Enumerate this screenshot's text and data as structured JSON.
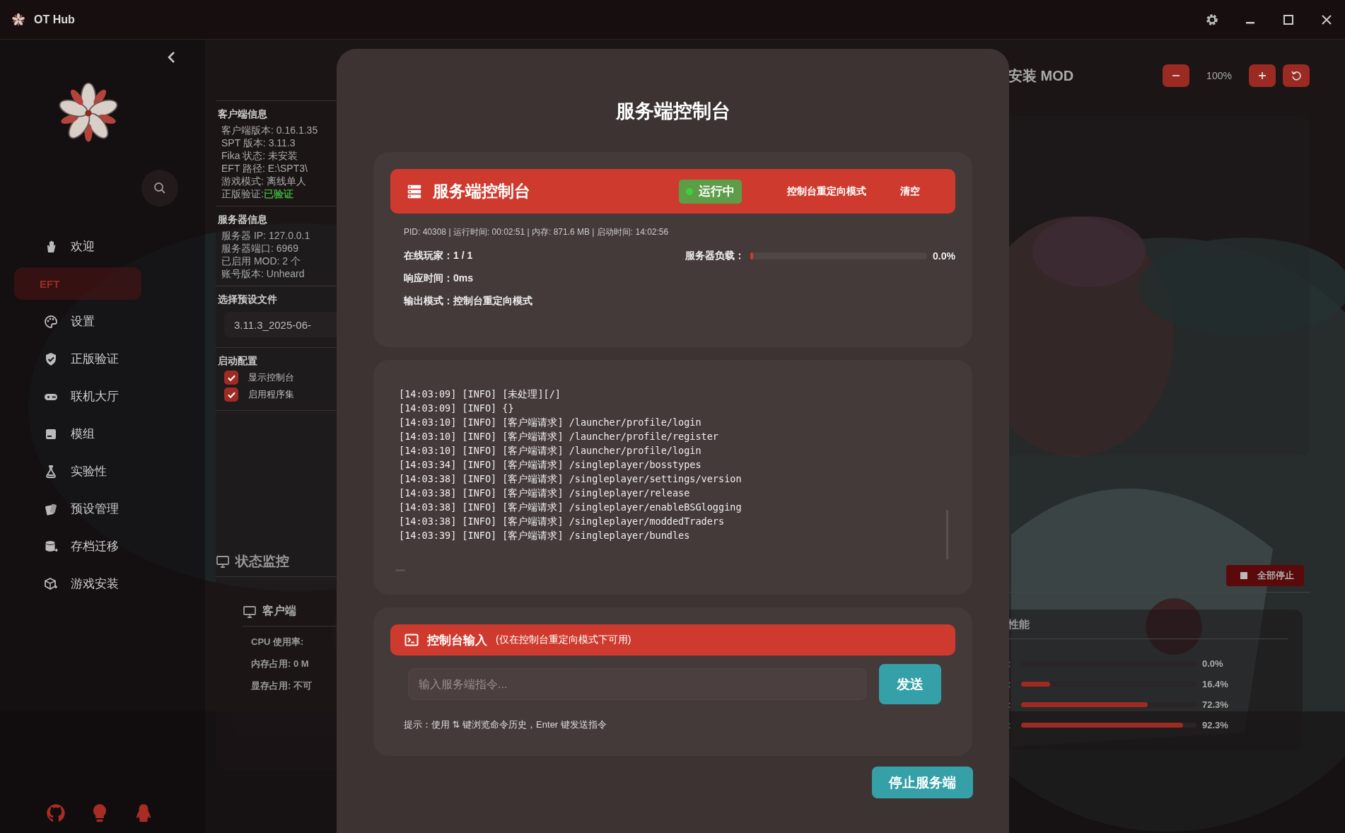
{
  "window": {
    "title": "OT Hub"
  },
  "sidebar": {
    "items": [
      {
        "label": "欢迎",
        "kind": "link",
        "selected": false
      },
      {
        "label": "EFT",
        "kind": "section",
        "selected": true
      },
      {
        "label": "设置",
        "kind": "link",
        "selected": false
      },
      {
        "label": "正版验证",
        "kind": "link",
        "selected": false
      },
      {
        "label": "联机大厅",
        "kind": "link",
        "selected": false
      },
      {
        "label": "模组",
        "kind": "link",
        "selected": false
      },
      {
        "label": "实验性",
        "kind": "link",
        "selected": false
      },
      {
        "label": "预设管理",
        "kind": "link",
        "selected": false
      },
      {
        "label": "存档迁移",
        "kind": "link",
        "selected": false
      },
      {
        "label": "游戏安装",
        "kind": "link",
        "selected": false
      }
    ]
  },
  "client_info": {
    "title": "客户端信息",
    "rows": [
      {
        "label": "客户端版本:",
        "value": "0.16.1.35",
        "kind": "plain"
      },
      {
        "label": "SPT 版本:",
        "value": "3.11.3",
        "kind": "plain"
      },
      {
        "label": "Fika 状态:",
        "value": "未安装",
        "kind": "plain"
      },
      {
        "label": "EFT 路径:",
        "value": "E:\\SPT3\\",
        "kind": "plain"
      },
      {
        "label": "游戏模式:",
        "value": "离线单人",
        "kind": "plain"
      },
      {
        "label": "正版验证:",
        "value": "已验证",
        "kind": "status"
      }
    ]
  },
  "server_info": {
    "title": "服务器信息",
    "rows": [
      {
        "label": "服务器 IP:",
        "value": "127.0.0.1",
        "kind": "plain"
      },
      {
        "label": "服务器端口:",
        "value": "6969",
        "kind": "plain"
      },
      {
        "label": "已启用 MOD:",
        "value": "2 个",
        "kind": "plain"
      },
      {
        "label": "账号版本:",
        "value": "Unheard",
        "kind": "plain"
      }
    ]
  },
  "preset": {
    "title": "选择预设文件",
    "value": "3.11.3_2025-06-"
  },
  "launch_config": {
    "title": "启动配置",
    "options": [
      {
        "label": "显示控制台",
        "checked": true
      },
      {
        "label": "启用程序集",
        "checked": true
      }
    ]
  },
  "monitor": {
    "title": "状态监控",
    "client": {
      "title": "客户端",
      "rows": [
        {
          "label": "CPU 使用率:",
          "value": ""
        },
        {
          "label": "内存占用:",
          "value": "0 M"
        },
        {
          "label": "显存占用:",
          "value": "不可"
        }
      ]
    }
  },
  "right_panel": {
    "title": "安装 MOD",
    "zoom_reading": "100%",
    "stop_all": "全部停止",
    "performance": {
      "title": "性能",
      "meters": [
        {
          "label": ":",
          "level": 0,
          "reading": "0.0%"
        },
        {
          "label": ":",
          "level": 0.164,
          "reading": "16.4%"
        },
        {
          "label": ":",
          "level": 0.723,
          "reading": "72.3%"
        },
        {
          "label": ":",
          "level": 0.923,
          "reading": "92.3%"
        }
      ]
    }
  },
  "modal": {
    "title": "服务端控制台",
    "header": {
      "title": "服务端控制台",
      "status": {
        "label": "运行中",
        "running": true
      },
      "buttons": [
        "控制台重定向模式",
        "清空"
      ]
    },
    "info": "PID: 40308 | 运行时间: 00:02:51 | 内存: 871.6 MB | 启动时间: 14:02:56",
    "players": {
      "label": "在线玩家：",
      "value": "1 / 1"
    },
    "load": {
      "label": "服务器负载：",
      "level": 0,
      "reading": "0.0%"
    },
    "response": {
      "label": "响应时间：",
      "value": "0ms"
    },
    "output_mode": {
      "label": "输出模式：",
      "value": "控制台重定向模式"
    },
    "log": [
      "[14:03:09] [INFO] [未处理][/]",
      "[14:03:09] [INFO] {}",
      "[14:03:10] [INFO] [客户端请求] /launcher/profile/login",
      "[14:03:10] [INFO] [客户端请求] /launcher/profile/register",
      "[14:03:10] [INFO] [客户端请求] /launcher/profile/login",
      "[14:03:34] [INFO] [客户端请求] /singleplayer/bosstypes",
      "[14:03:38] [INFO] [客户端请求] /singleplayer/settings/version",
      "[14:03:38] [INFO] [客户端请求] /singleplayer/release",
      "[14:03:38] [INFO] [客户端请求] /singleplayer/enableBSGlogging",
      "[14:03:38] [INFO] [客户端请求] /singleplayer/moddedTraders",
      "[14:03:39] [INFO] [客户端请求] /singleplayer/bundles"
    ],
    "input": {
      "title": "控制台输入",
      "note": "(仅在控制台重定向模式下可用)",
      "placeholder": "输入服务端指令...",
      "send": "发送",
      "hint": "提示：使用 ⇅ 键浏览命令历史，Enter 键发送指令"
    },
    "stop": "停止服务端"
  }
}
